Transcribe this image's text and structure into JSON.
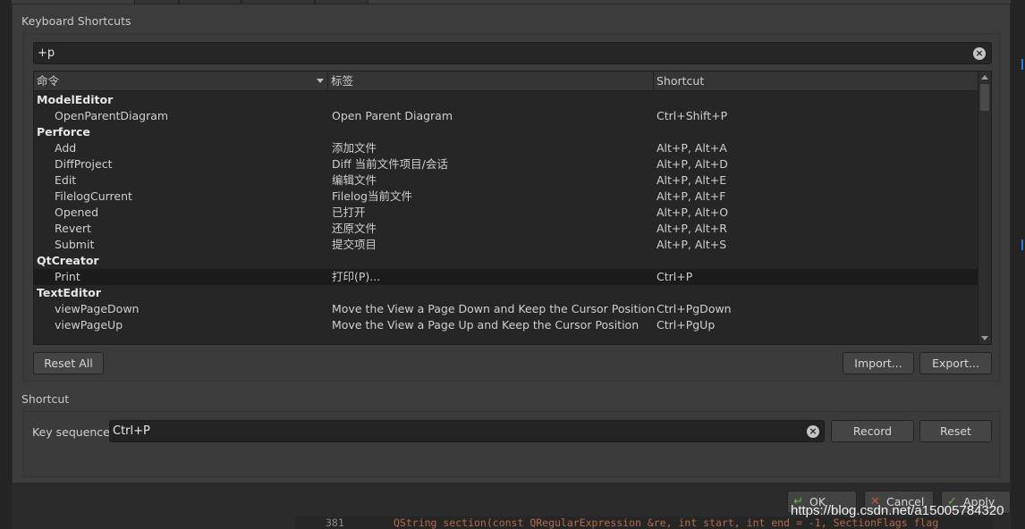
{
  "group_shortcuts_title": "Keyboard Shortcuts",
  "filter": {
    "value": "+p"
  },
  "tree": {
    "headers": [
      "命令",
      "标签",
      "Shortcut"
    ],
    "rows": [
      {
        "type": "category",
        "command": "ModelEditor",
        "label": "",
        "shortcut": ""
      },
      {
        "type": "item",
        "command": "OpenParentDiagram",
        "label": "Open Parent Diagram",
        "shortcut": "Ctrl+Shift+P"
      },
      {
        "type": "category",
        "command": "Perforce",
        "label": "",
        "shortcut": ""
      },
      {
        "type": "item",
        "command": "Add",
        "label": "添加文件",
        "shortcut": "Alt+P, Alt+A"
      },
      {
        "type": "item",
        "command": "DiffProject",
        "label": "Diff 当前文件项目/会话",
        "shortcut": "Alt+P, Alt+D"
      },
      {
        "type": "item",
        "command": "Edit",
        "label": "编辑文件",
        "shortcut": "Alt+P, Alt+E"
      },
      {
        "type": "item",
        "command": "FilelogCurrent",
        "label": "Filelog当前文件",
        "shortcut": "Alt+P, Alt+F"
      },
      {
        "type": "item",
        "command": "Opened",
        "label": "已打开",
        "shortcut": "Alt+P, Alt+O"
      },
      {
        "type": "item",
        "command": "Revert",
        "label": "还原文件",
        "shortcut": "Alt+P, Alt+R"
      },
      {
        "type": "item",
        "command": "Submit",
        "label": "提交项目",
        "shortcut": "Alt+P, Alt+S"
      },
      {
        "type": "category",
        "command": "QtCreator",
        "label": "",
        "shortcut": ""
      },
      {
        "type": "item",
        "command": "Print",
        "label": "打印(P)...",
        "shortcut": "Ctrl+P",
        "selected": true
      },
      {
        "type": "category",
        "command": "TextEditor",
        "label": "",
        "shortcut": ""
      },
      {
        "type": "item",
        "command": "viewPageDown",
        "label": "Move the View a Page Down and Keep the Cursor Position",
        "shortcut": "Ctrl+PgDown"
      },
      {
        "type": "item",
        "command": "viewPageUp",
        "label": "Move the View a Page Up and Keep the Cursor Position",
        "shortcut": "Ctrl+PgUp"
      }
    ]
  },
  "buttons": {
    "reset_all": "Reset All",
    "import": "Import...",
    "export": "Export..."
  },
  "shortcut_group": {
    "title": "Shortcut",
    "key_sequence_label": "Key sequence:",
    "key_sequence_value": "Ctrl+P",
    "record": "Record",
    "reset": "Reset"
  },
  "dialog": {
    "ok": "OK",
    "cancel": "Cancel",
    "apply": "Apply"
  },
  "editor": {
    "line_number": "381",
    "code": "QString section(const QRegularExpression &re, int start, int end = -1, SectionFlags flag"
  },
  "watermark": "https://blog.csdn.net/a15005784320",
  "colors": {
    "selected_row": "#1b1b1b",
    "panel": "#3c3c3c",
    "field": "#262626"
  }
}
